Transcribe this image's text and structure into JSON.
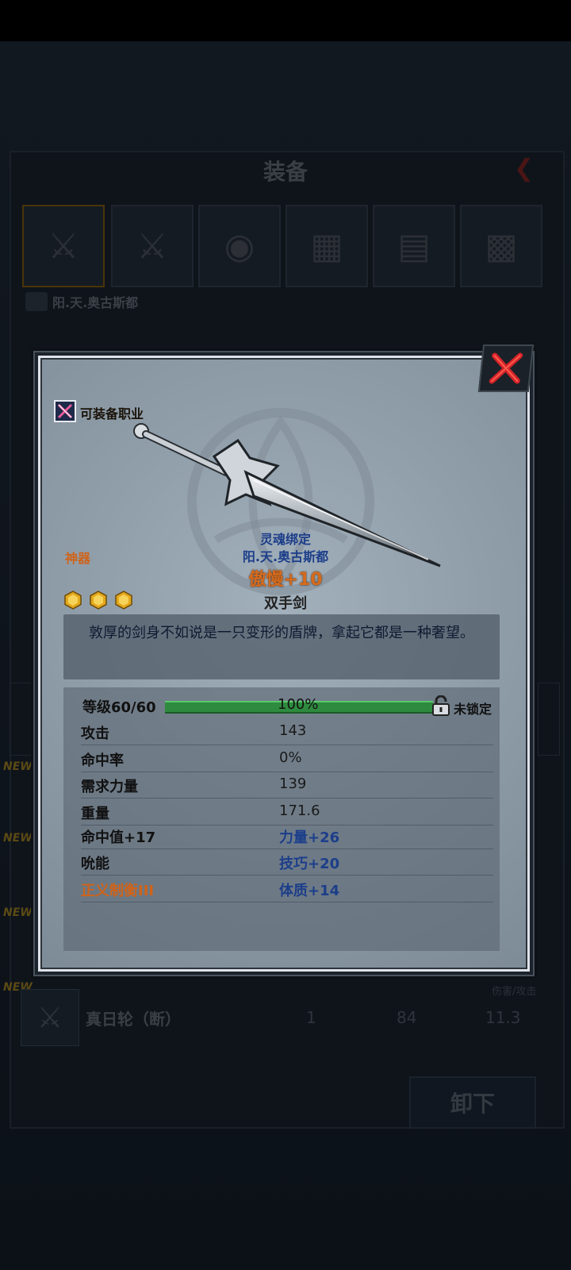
{
  "background": {
    "title": "装备",
    "owner": "阳.天.奥古斯都",
    "new_tag": "NEW",
    "list_header": "伤害/攻击",
    "row": {
      "name": "真日轮（断）",
      "c1": "1",
      "c2": "84",
      "c3": "11.3"
    },
    "unequip_label": "卸下"
  },
  "modal": {
    "class_label": "可装备职业",
    "rarity": "神器",
    "bind_status": "灵魂绑定",
    "bind_owner": "阳.天.奥古斯都",
    "weapon_name": "傲慢+10",
    "weapon_type": "双手剑",
    "star_count": 3,
    "description": "敦厚的剑身不如说是一只变形的盾牌，拿起它都是一种奢望。",
    "level": {
      "label": "等级60/60",
      "percent": "100%",
      "progress": 1.0,
      "lock_label": "未锁定"
    },
    "stats": [
      {
        "label": "攻击",
        "value": "143"
      },
      {
        "label": "命中率",
        "value": "0%"
      },
      {
        "label": "需求力量",
        "value": "139"
      },
      {
        "label": "重量",
        "value": "171.6"
      },
      {
        "label": "命中值+17",
        "value": "力量+26"
      },
      {
        "label": "吮能",
        "value": "技巧+20"
      },
      {
        "label": "正义制衡III",
        "value": "体质+14"
      }
    ]
  },
  "colors": {
    "rarity": "#d0631a",
    "bind": "#1c3e8a",
    "bar": "#2e8a3e",
    "close": "#d2232a"
  },
  "icons": {
    "close": "close-x-icon",
    "class": "crossed-swords-icon",
    "star": "hexagon-gem-icon",
    "lock": "padlock-icon"
  }
}
